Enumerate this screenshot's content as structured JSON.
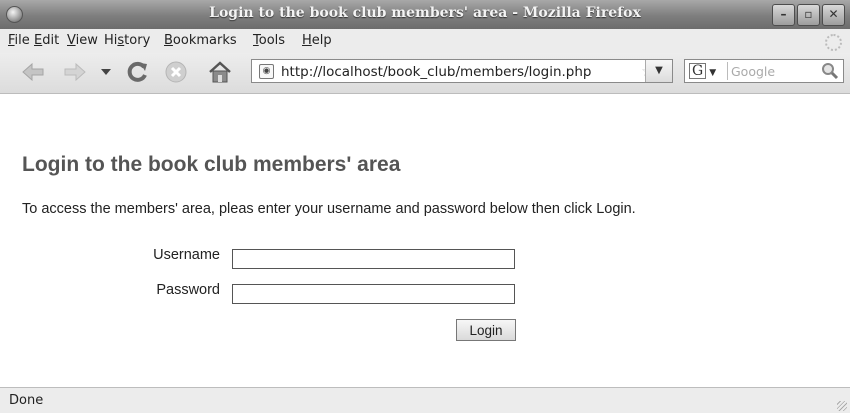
{
  "window": {
    "title": "Login to the book club members' area - Mozilla Firefox",
    "controls": [
      "minimize",
      "maximize",
      "close"
    ]
  },
  "menu": {
    "items": [
      {
        "label": "File",
        "accel": "F"
      },
      {
        "label": "Edit",
        "accel": "E"
      },
      {
        "label": "View",
        "accel": "V"
      },
      {
        "label": "History",
        "accel": "s"
      },
      {
        "label": "Bookmarks",
        "accel": "B"
      },
      {
        "label": "Tools",
        "accel": "T"
      },
      {
        "label": "Help",
        "accel": "H"
      }
    ]
  },
  "toolbar": {
    "icons": [
      "back-icon",
      "forward-icon",
      "history-dropdown-icon",
      "reload-icon",
      "stop-icon",
      "home-icon"
    ],
    "url": "http://localhost/book_club/members/login.php",
    "search_engine": "G",
    "search_placeholder": "Google"
  },
  "page": {
    "heading": "Login to the book club members' area",
    "intro": "To access the members' area, pleas enter your username and password below then click Login.",
    "form": {
      "username_label": "Username",
      "username_value": "",
      "password_label": "Password",
      "password_value": "",
      "submit_label": "Login"
    }
  },
  "status": {
    "text": "Done"
  },
  "colors": {
    "titlebar": "#7e7e7e",
    "heading": "#555555",
    "chrome": "#ececec"
  }
}
